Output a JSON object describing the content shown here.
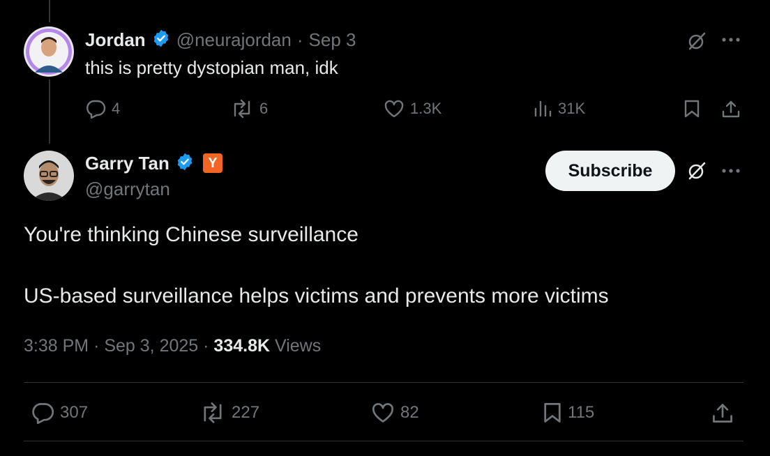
{
  "reply_tweet": {
    "author_name": "Jordan",
    "author_handle": "@neurajordan",
    "separator": "·",
    "date": "Sep 3",
    "text": "this is pretty dystopian man, idk",
    "actions": {
      "replies": "4",
      "reposts": "6",
      "likes": "1.3K",
      "views": "31K"
    }
  },
  "main_tweet": {
    "author_name": "Garry Tan",
    "author_handle": "@garrytan",
    "affiliate_badge": "Y",
    "subscribe_label": "Subscribe",
    "text_line1": "You're thinking Chinese surveillance",
    "text_line2": "US-based surveillance helps victims and prevents more victims",
    "time": "3:38 PM",
    "dot1": "·",
    "date": "Sep 3, 2025",
    "dot2": "·",
    "views_count": "334.8K",
    "views_label": "Views",
    "actions": {
      "replies": "307",
      "reposts": "227",
      "likes": "82",
      "bookmarks": "115"
    }
  },
  "colors": {
    "background": "#000000",
    "text_primary": "#e7e9ea",
    "text_secondary": "#71767b",
    "verified_blue": "#1d9bf0",
    "yc_orange": "#f26522",
    "divider": "#2f3336"
  },
  "icons": [
    "verified-badge-icon",
    "grok-icon",
    "more-icon",
    "reply-icon",
    "repost-icon",
    "like-icon",
    "views-icon",
    "bookmark-icon",
    "share-icon"
  ]
}
